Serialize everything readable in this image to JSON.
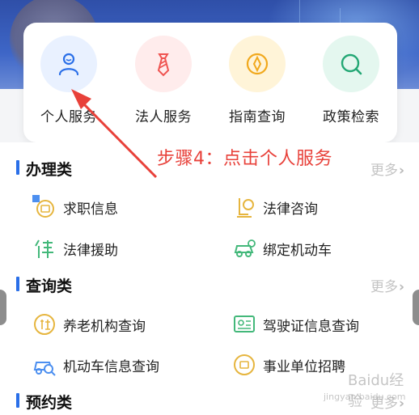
{
  "quick_services": [
    {
      "label": "个人服务",
      "icon": "person-icon",
      "bg": "#e9f1ff",
      "color": "#2a6fe8"
    },
    {
      "label": "法人服务",
      "icon": "tie-icon",
      "bg": "#ffecec",
      "color": "#ef5350"
    },
    {
      "label": "指南查询",
      "icon": "compass-icon",
      "bg": "#fff4d8",
      "color": "#f1a81c"
    },
    {
      "label": "政策检索",
      "icon": "search-icon",
      "bg": "#e4f7ef",
      "color": "#22a774"
    }
  ],
  "annotation": "步骤4：点击个人服务",
  "sections": [
    {
      "title": "办理类",
      "more": "更多"
    },
    {
      "title": "查询类",
      "more": "更多"
    },
    {
      "title": "预约类",
      "more": "更多"
    }
  ],
  "services": {
    "handling": [
      {
        "label": "求职信息",
        "icon": "job-icon"
      },
      {
        "label": "法律咨询",
        "icon": "law-consult-icon"
      },
      {
        "label": "法律援助",
        "icon": "law-aid-icon"
      },
      {
        "label": "绑定机动车",
        "icon": "car-bind-icon"
      }
    ],
    "query": [
      {
        "label": "养老机构查询",
        "icon": "elderly-care-icon"
      },
      {
        "label": "驾驶证信息查询",
        "icon": "driver-license-icon"
      },
      {
        "label": "机动车信息查询",
        "icon": "vehicle-search-icon"
      },
      {
        "label": "事业单位招聘",
        "icon": "recruitment-icon"
      }
    ]
  },
  "watermark": {
    "logo": "Baidu经验",
    "url": "jingyan.baidu.com"
  },
  "colors": {
    "accent": "#2a6fe8",
    "annotation": "#e8413a",
    "more": "#c4c4c4"
  }
}
